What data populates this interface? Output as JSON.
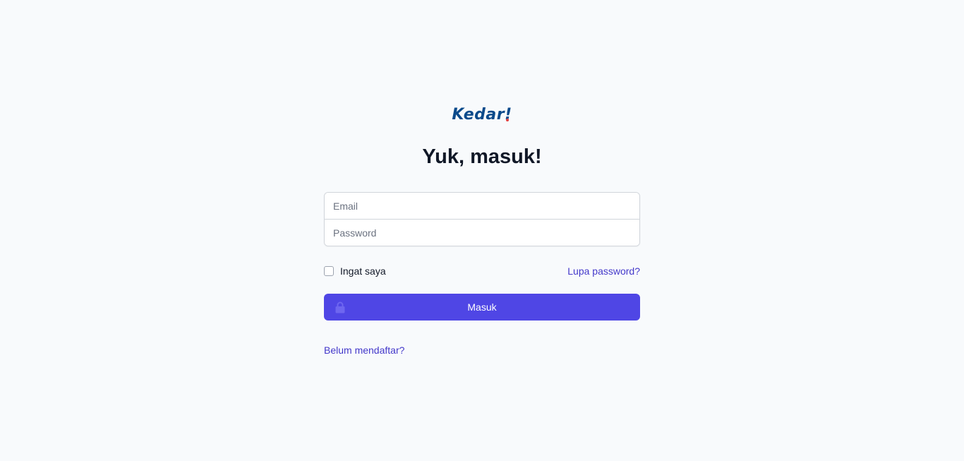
{
  "brand": {
    "name": "Kedar",
    "mark": "!",
    "primary_color": "#0b4a8b",
    "dot_color": "#e53e3e"
  },
  "heading": "Yuk, masuk!",
  "form": {
    "email": {
      "placeholder": "Email",
      "value": ""
    },
    "password": {
      "placeholder": "Password",
      "value": ""
    },
    "remember_label": "Ingat saya",
    "remember_checked": false,
    "forgot_label": "Lupa password?",
    "submit_label": "Masuk",
    "submit_icon": "lock-icon"
  },
  "signup_label": "Belum mendaftar?",
  "colors": {
    "accent": "#4f46e5",
    "link": "#4338ca",
    "background": "#f8fafc"
  }
}
